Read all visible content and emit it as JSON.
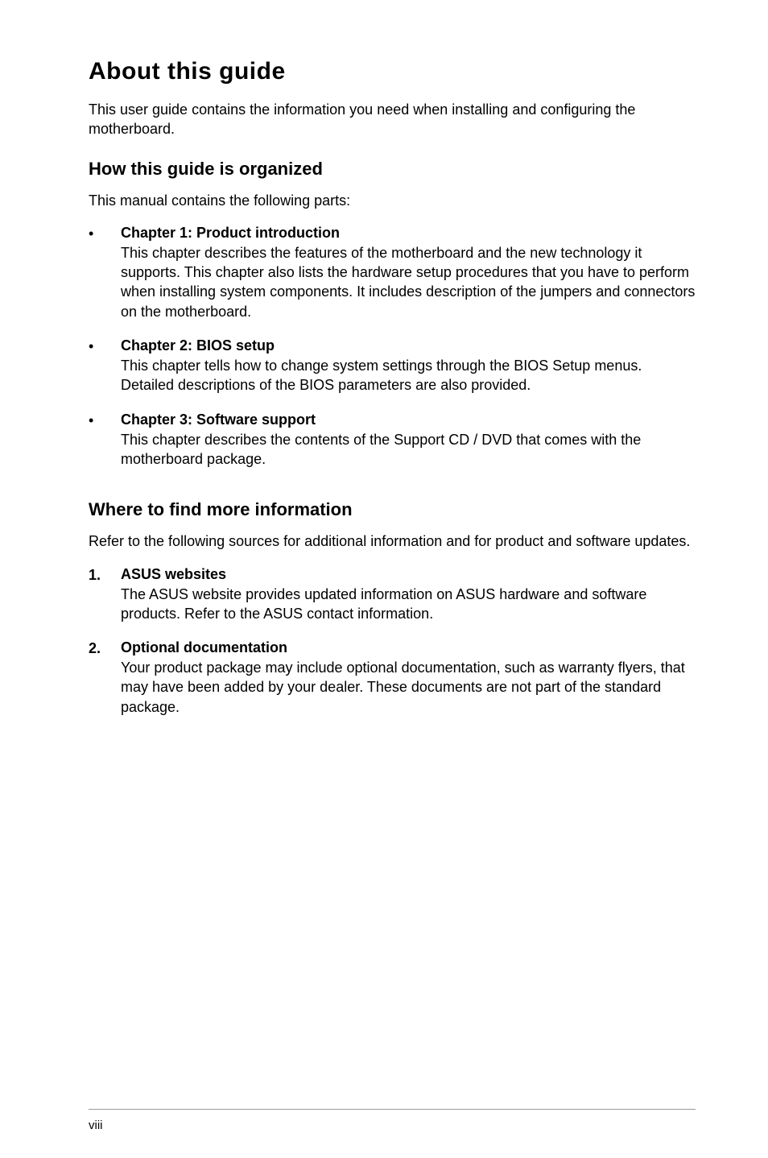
{
  "title": "About this guide",
  "intro": "This user guide contains the information you need when installing and configuring the motherboard.",
  "section1": {
    "heading": "How this guide is organized",
    "intro": "This manual contains the following parts:",
    "items": [
      {
        "marker": "•",
        "title": "Chapter 1: Product introduction",
        "body": "This chapter describes the features of the motherboard and the new technology it supports. This chapter also lists the hardware setup procedures that you have to perform when installing system components. It includes description of the jumpers and connectors on the motherboard."
      },
      {
        "marker": "•",
        "title": "Chapter 2: BIOS setup",
        "body": "This chapter tells how to change system settings through the BIOS Setup menus. Detailed descriptions of the BIOS parameters are also provided."
      },
      {
        "marker": "•",
        "title": "Chapter 3: Software support",
        "body": "This chapter describes the contents of the Support CD / DVD that comes with the motherboard package."
      }
    ]
  },
  "section2": {
    "heading": "Where to find more information",
    "intro": "Refer to the following sources for additional information and for product and software updates.",
    "items": [
      {
        "marker": "1.",
        "title": "ASUS websites",
        "body": "The ASUS website provides updated information on ASUS hardware and software products. Refer to the ASUS contact information."
      },
      {
        "marker": "2.",
        "title": "Optional documentation",
        "body": "Your product package may include optional documentation, such as warranty flyers, that may have been added by your dealer. These documents are not part of the standard package."
      }
    ]
  },
  "pageNumber": "viii"
}
